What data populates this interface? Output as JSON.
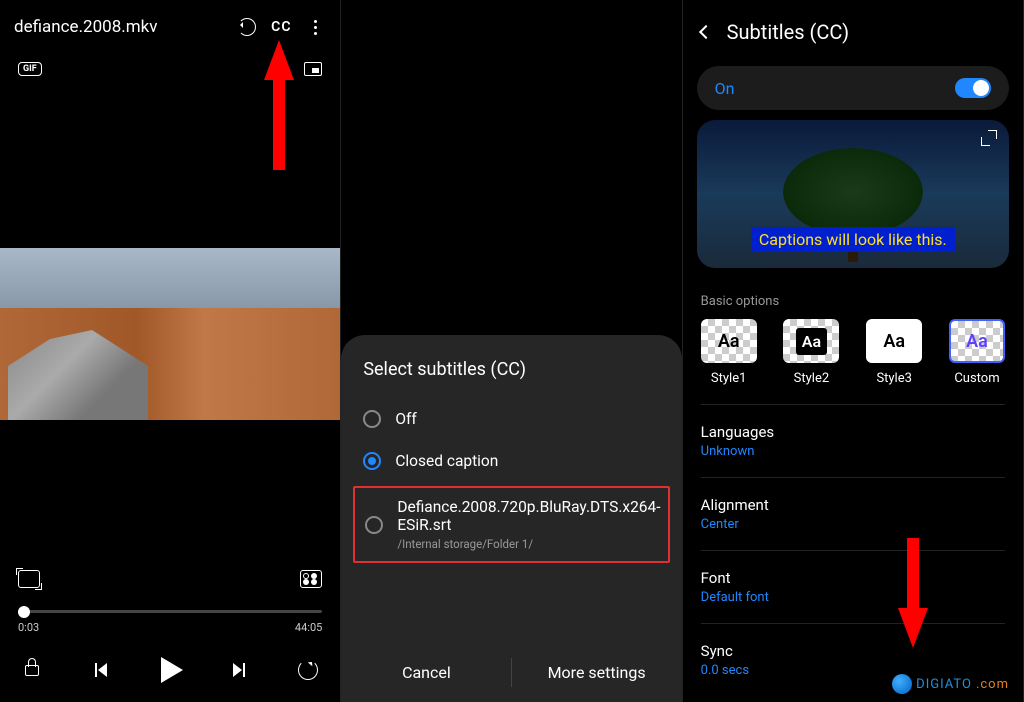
{
  "panel1": {
    "title": "defiance.2008.mkv",
    "cc_label": "CC",
    "gif_label": "GIF",
    "time_current": "0:03",
    "time_total": "44:05"
  },
  "panel2": {
    "sheet_title": "Select subtitles (CC)",
    "opt_off": "Off",
    "opt_cc": "Closed caption",
    "opt_file_name": "Defiance.2008.720p.BluRay.DTS.x264-ESiR.srt",
    "opt_file_path": "/Internal storage/Folder 1/",
    "btn_cancel": "Cancel",
    "btn_more": "More settings"
  },
  "panel3": {
    "title": "Subtitles (CC)",
    "toggle_label": "On",
    "caption_sample": "Captions will look like this.",
    "section_label": "Basic options",
    "styles": {
      "s1": "Style1",
      "s2": "Style2",
      "s3": "Style3",
      "s4": "Custom",
      "aa": "Aa"
    },
    "languages_label": "Languages",
    "languages_value": "Unknown",
    "alignment_label": "Alignment",
    "alignment_value": "Center",
    "font_label": "Font",
    "font_value": "Default font",
    "sync_label": "Sync",
    "sync_value": "0.0 secs"
  },
  "watermark": {
    "text1": "DIGIATO",
    "text2": ".com"
  }
}
